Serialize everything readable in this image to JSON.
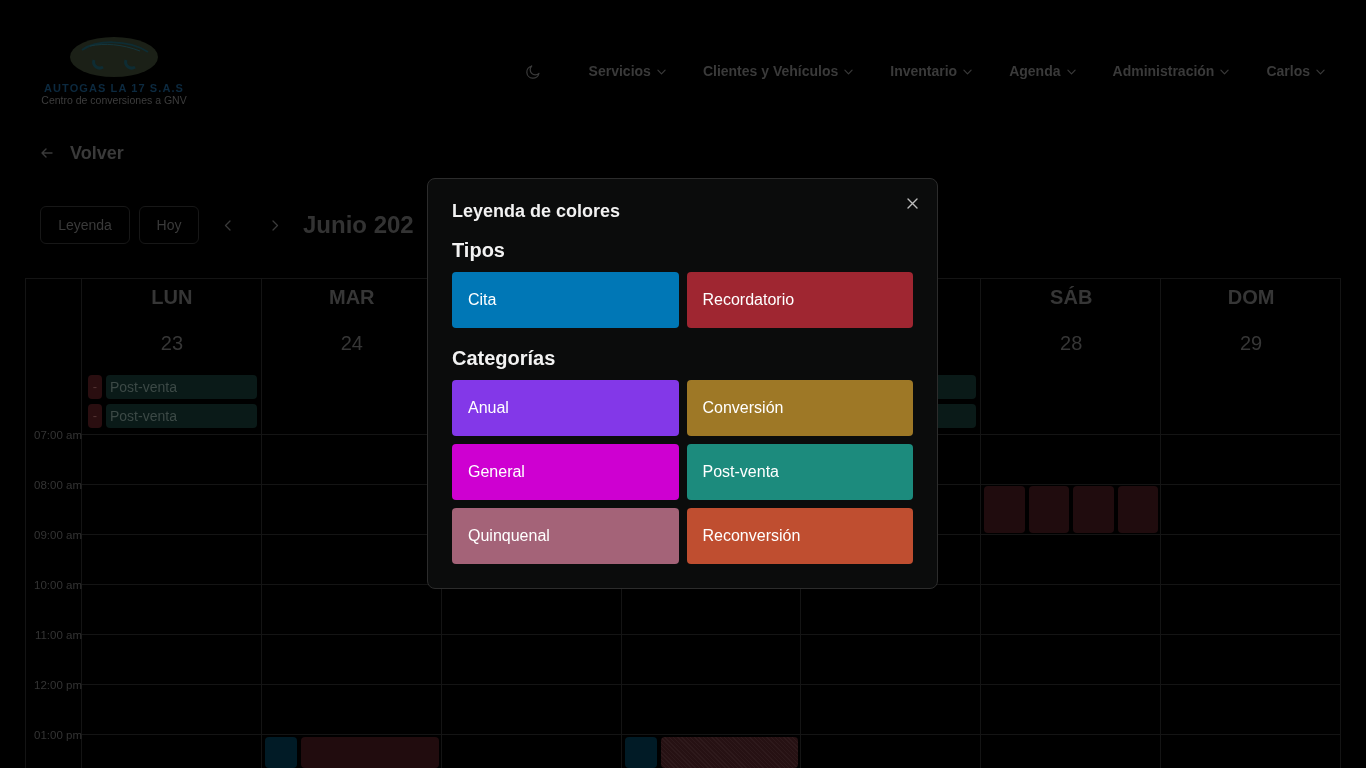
{
  "navbar": {
    "logo": {
      "name": "AUTOGAS LA 17 S.A.S",
      "tagline": "Centro de conversiones a GNV"
    },
    "menu": [
      {
        "label": "Servicios"
      },
      {
        "label": "Clientes y Vehículos"
      },
      {
        "label": "Inventario"
      },
      {
        "label": "Agenda"
      },
      {
        "label": "Administración"
      },
      {
        "label": "Carlos"
      }
    ]
  },
  "back_link": {
    "label": "Volver"
  },
  "toolbar": {
    "buttons": [
      "Leyenda",
      "Hoy"
    ],
    "title": "Junio 202"
  },
  "calendar": {
    "header": {
      "cells": [
        {
          "name": "LUN",
          "number": "23"
        },
        {
          "name": "MAR",
          "number": "24"
        },
        null,
        null,
        null,
        {
          "name": "SÁB",
          "number": "28"
        },
        {
          "name": "DOM",
          "number": "29"
        }
      ]
    },
    "all_day": {
      "cells": [
        {
          "events": [
            {
              "tag": {
                "text": "-",
                "color": "#2a0e10"
              },
              "label": "Post-venta",
              "color": "#0a1a18"
            },
            {
              "tag": {
                "text": "-",
                "color": "#2a0e10"
              },
              "label": "Post-venta",
              "color": "#0a1a18"
            }
          ]
        },
        null,
        null,
        null,
        {
          "events": [
            {
              "color": "#0a1a18"
            },
            {
              "color": "#0a1a18"
            }
          ]
        },
        null,
        null
      ]
    },
    "rows": [
      {
        "time": "07:00 am"
      },
      {
        "time": "08:00 am",
        "cells": [
          null,
          null,
          null,
          null,
          null,
          {
            "events": [
              {
                "kind": "block",
                "color": "#200c0e"
              },
              {
                "kind": "block",
                "color": "#200c0e"
              },
              {
                "kind": "block",
                "color": "#200c0e"
              },
              {
                "kind": "block",
                "color": "#200c0e"
              }
            ]
          },
          null
        ]
      },
      {
        "time": "09:00 am"
      },
      {
        "time": "10:00 am"
      },
      {
        "time": "11:00 am"
      },
      {
        "time": "12:00 pm"
      },
      {
        "time": "01:00 pm",
        "cells": [
          null,
          {
            "events": [
              {
                "kind": "marker",
                "color": "#011b26"
              },
              {
                "kind": "block",
                "color": "#210c0e"
              }
            ]
          },
          null,
          {
            "events": [
              {
                "kind": "marker",
                "color": "#011b26"
              },
              {
                "kind": "hatched",
                "color": "#261113"
              }
            ]
          },
          null,
          null,
          null
        ]
      }
    ]
  },
  "legend_modal": {
    "title": "Leyenda de colores",
    "sections": [
      {
        "heading": "Tipos",
        "items": [
          {
            "label": "Cita",
            "color": "#0077b6"
          },
          {
            "label": "Recordatorio",
            "color": "#9f2631"
          }
        ]
      },
      {
        "heading": "Categorías",
        "items": [
          {
            "label": "Anual",
            "color": "#8338e8"
          },
          {
            "label": "Conversión",
            "color": "#9e7826"
          },
          {
            "label": "General",
            "color": "#ce00d1"
          },
          {
            "label": "Post-venta",
            "color": "#1c8b7d"
          },
          {
            "label": "Quinquenal",
            "color": "#a46378"
          },
          {
            "label": "Reconversión",
            "color": "#bf4e30"
          }
        ]
      }
    ]
  }
}
